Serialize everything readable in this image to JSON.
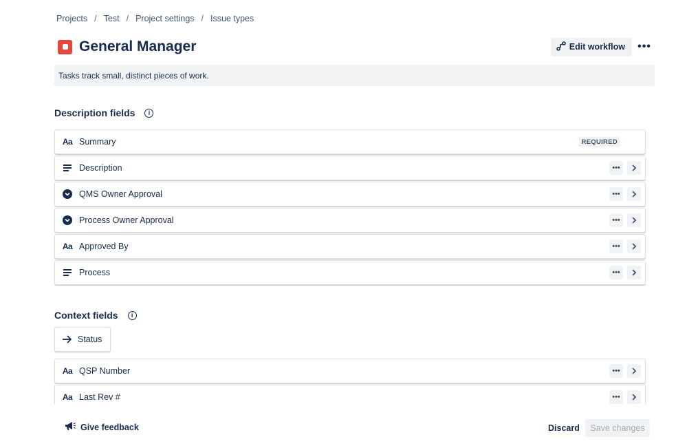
{
  "breadcrumb": [
    "Projects",
    "Test",
    "Project settings",
    "Issue types"
  ],
  "breadcrumb_separator": "/",
  "header": {
    "title": "General Manager",
    "icon_color": "#E2483D",
    "edit_workflow_label": "Edit workflow",
    "more_label": "•••"
  },
  "description": "Tasks track small, distinct pieces of work.",
  "description_fields": {
    "heading": "Description fields",
    "items": [
      {
        "icon": "text-icon",
        "label": "Summary",
        "badge": "REQUIRED"
      },
      {
        "icon": "paragraph-icon",
        "label": "Description"
      },
      {
        "icon": "select-icon",
        "label": "QMS Owner Approval"
      },
      {
        "icon": "select-icon",
        "label": "Process Owner Approval"
      },
      {
        "icon": "text-icon",
        "label": "Approved By"
      },
      {
        "icon": "paragraph-icon",
        "label": "Process"
      }
    ]
  },
  "context_fields": {
    "heading": "Context fields",
    "status_label": "Status",
    "items": [
      {
        "icon": "text-icon",
        "label": "QSP Number"
      },
      {
        "icon": "text-icon",
        "label": "Last Rev #"
      }
    ]
  },
  "footer": {
    "feedback_label": "Give feedback",
    "discard_label": "Discard",
    "save_label": "Save changes"
  },
  "colors": {
    "text": "#172B4D",
    "subtle_bg": "#F1F2F4",
    "issue_type": "#E2483D"
  }
}
